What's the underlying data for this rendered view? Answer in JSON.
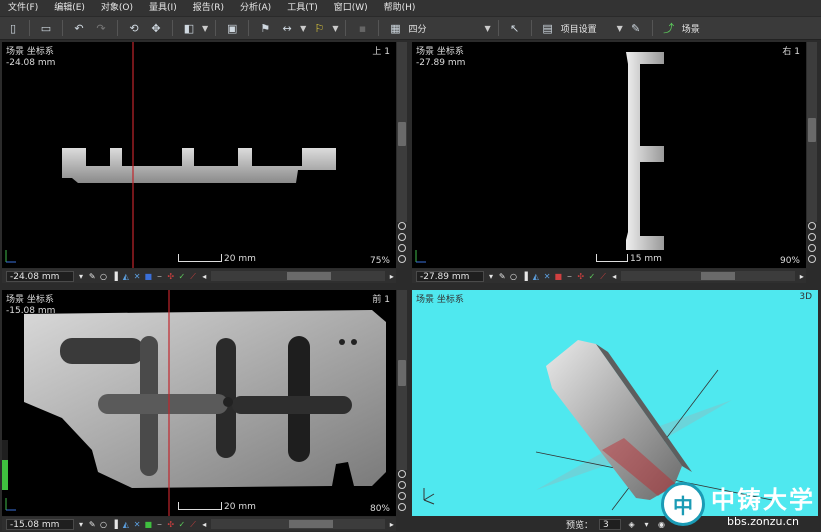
{
  "menu": [
    "文件(F)",
    "编辑(E)",
    "对象(O)",
    "量具(I)",
    "报告(R)",
    "分析(A)",
    "工具(T)",
    "窗口(W)",
    "帮助(H)"
  ],
  "toolbar": {
    "layout_label": "四分",
    "settings_label": "项目设置",
    "scene_label": "场景"
  },
  "viewports": {
    "top_left": {
      "title": "场景 坐标系",
      "pos": "-24.08 mm",
      "view": "上 1",
      "scale": "20 mm",
      "zoom": "75%",
      "status_value": "-24.08 mm"
    },
    "top_right": {
      "title": "场景 坐标系",
      "pos": "-27.89 mm",
      "view": "右 1",
      "scale": "15 mm",
      "zoom": "90%",
      "status_value": "-27.89 mm"
    },
    "bottom_left": {
      "title": "场景 坐标系",
      "pos": "-15.08 mm",
      "view": "前 1",
      "scale": "20 mm",
      "zoom": "80%",
      "status_value": "-15.08 mm"
    },
    "bottom_right": {
      "title": "场景 坐标系",
      "view": "3D",
      "preview_label": "预览：",
      "preview_value": "3"
    }
  },
  "watermark": {
    "title": "中铸大学",
    "url": "bbs.zonzu.cn",
    "logo_char": "中"
  },
  "colors": {
    "accent_line": "#c0262c",
    "viewport3d_bg": "#4fe8ef",
    "background": "#2b2b2b"
  },
  "icons": [
    "undo-icon",
    "redo-icon",
    "open-icon",
    "new-icon",
    "move-icon",
    "scene-icon",
    "settings-icon"
  ]
}
